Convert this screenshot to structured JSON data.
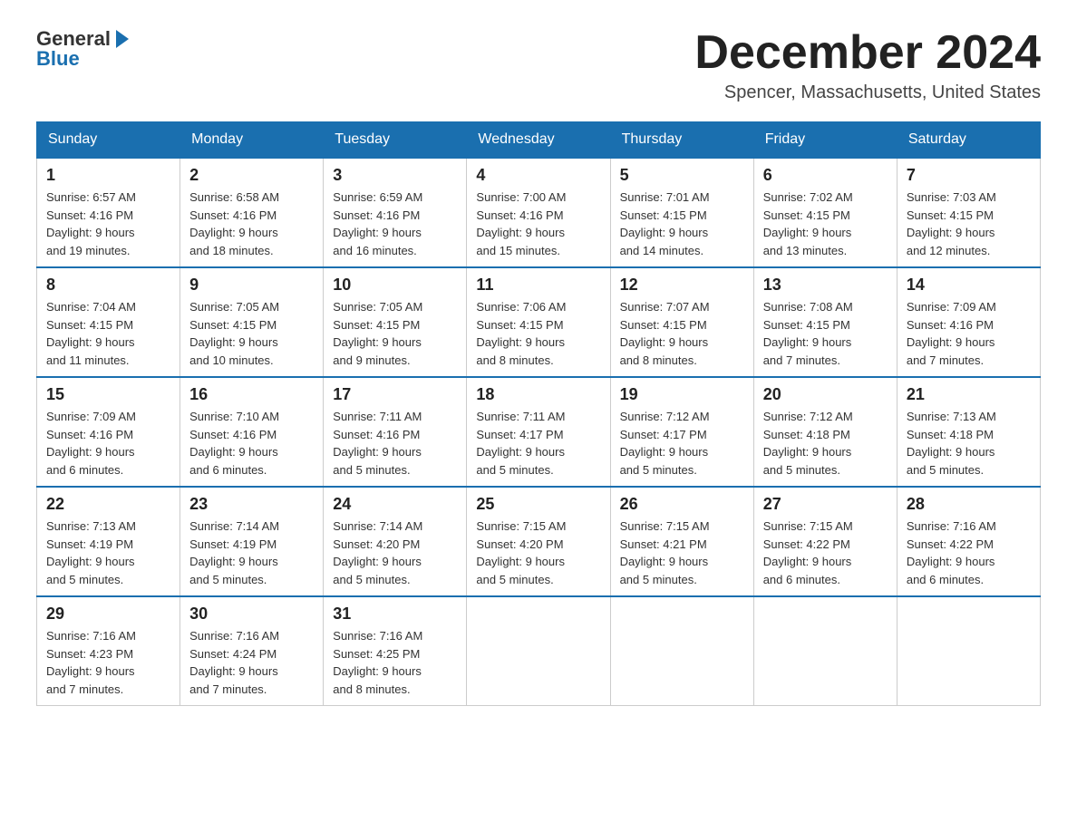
{
  "header": {
    "logo_general": "General",
    "logo_blue": "Blue",
    "main_title": "December 2024",
    "subtitle": "Spencer, Massachusetts, United States"
  },
  "calendar": {
    "days_of_week": [
      "Sunday",
      "Monday",
      "Tuesday",
      "Wednesday",
      "Thursday",
      "Friday",
      "Saturday"
    ],
    "weeks": [
      [
        {
          "day": "1",
          "sunrise": "6:57 AM",
          "sunset": "4:16 PM",
          "daylight": "9 hours and 19 minutes."
        },
        {
          "day": "2",
          "sunrise": "6:58 AM",
          "sunset": "4:16 PM",
          "daylight": "9 hours and 18 minutes."
        },
        {
          "day": "3",
          "sunrise": "6:59 AM",
          "sunset": "4:16 PM",
          "daylight": "9 hours and 16 minutes."
        },
        {
          "day": "4",
          "sunrise": "7:00 AM",
          "sunset": "4:16 PM",
          "daylight": "9 hours and 15 minutes."
        },
        {
          "day": "5",
          "sunrise": "7:01 AM",
          "sunset": "4:15 PM",
          "daylight": "9 hours and 14 minutes."
        },
        {
          "day": "6",
          "sunrise": "7:02 AM",
          "sunset": "4:15 PM",
          "daylight": "9 hours and 13 minutes."
        },
        {
          "day": "7",
          "sunrise": "7:03 AM",
          "sunset": "4:15 PM",
          "daylight": "9 hours and 12 minutes."
        }
      ],
      [
        {
          "day": "8",
          "sunrise": "7:04 AM",
          "sunset": "4:15 PM",
          "daylight": "9 hours and 11 minutes."
        },
        {
          "day": "9",
          "sunrise": "7:05 AM",
          "sunset": "4:15 PM",
          "daylight": "9 hours and 10 minutes."
        },
        {
          "day": "10",
          "sunrise": "7:05 AM",
          "sunset": "4:15 PM",
          "daylight": "9 hours and 9 minutes."
        },
        {
          "day": "11",
          "sunrise": "7:06 AM",
          "sunset": "4:15 PM",
          "daylight": "9 hours and 8 minutes."
        },
        {
          "day": "12",
          "sunrise": "7:07 AM",
          "sunset": "4:15 PM",
          "daylight": "9 hours and 8 minutes."
        },
        {
          "day": "13",
          "sunrise": "7:08 AM",
          "sunset": "4:15 PM",
          "daylight": "9 hours and 7 minutes."
        },
        {
          "day": "14",
          "sunrise": "7:09 AM",
          "sunset": "4:16 PM",
          "daylight": "9 hours and 7 minutes."
        }
      ],
      [
        {
          "day": "15",
          "sunrise": "7:09 AM",
          "sunset": "4:16 PM",
          "daylight": "9 hours and 6 minutes."
        },
        {
          "day": "16",
          "sunrise": "7:10 AM",
          "sunset": "4:16 PM",
          "daylight": "9 hours and 6 minutes."
        },
        {
          "day": "17",
          "sunrise": "7:11 AM",
          "sunset": "4:16 PM",
          "daylight": "9 hours and 5 minutes."
        },
        {
          "day": "18",
          "sunrise": "7:11 AM",
          "sunset": "4:17 PM",
          "daylight": "9 hours and 5 minutes."
        },
        {
          "day": "19",
          "sunrise": "7:12 AM",
          "sunset": "4:17 PM",
          "daylight": "9 hours and 5 minutes."
        },
        {
          "day": "20",
          "sunrise": "7:12 AM",
          "sunset": "4:18 PM",
          "daylight": "9 hours and 5 minutes."
        },
        {
          "day": "21",
          "sunrise": "7:13 AM",
          "sunset": "4:18 PM",
          "daylight": "9 hours and 5 minutes."
        }
      ],
      [
        {
          "day": "22",
          "sunrise": "7:13 AM",
          "sunset": "4:19 PM",
          "daylight": "9 hours and 5 minutes."
        },
        {
          "day": "23",
          "sunrise": "7:14 AM",
          "sunset": "4:19 PM",
          "daylight": "9 hours and 5 minutes."
        },
        {
          "day": "24",
          "sunrise": "7:14 AM",
          "sunset": "4:20 PM",
          "daylight": "9 hours and 5 minutes."
        },
        {
          "day": "25",
          "sunrise": "7:15 AM",
          "sunset": "4:20 PM",
          "daylight": "9 hours and 5 minutes."
        },
        {
          "day": "26",
          "sunrise": "7:15 AM",
          "sunset": "4:21 PM",
          "daylight": "9 hours and 5 minutes."
        },
        {
          "day": "27",
          "sunrise": "7:15 AM",
          "sunset": "4:22 PM",
          "daylight": "9 hours and 6 minutes."
        },
        {
          "day": "28",
          "sunrise": "7:16 AM",
          "sunset": "4:22 PM",
          "daylight": "9 hours and 6 minutes."
        }
      ],
      [
        {
          "day": "29",
          "sunrise": "7:16 AM",
          "sunset": "4:23 PM",
          "daylight": "9 hours and 7 minutes."
        },
        {
          "day": "30",
          "sunrise": "7:16 AM",
          "sunset": "4:24 PM",
          "daylight": "9 hours and 7 minutes."
        },
        {
          "day": "31",
          "sunrise": "7:16 AM",
          "sunset": "4:25 PM",
          "daylight": "9 hours and 8 minutes."
        },
        null,
        null,
        null,
        null
      ]
    ]
  }
}
